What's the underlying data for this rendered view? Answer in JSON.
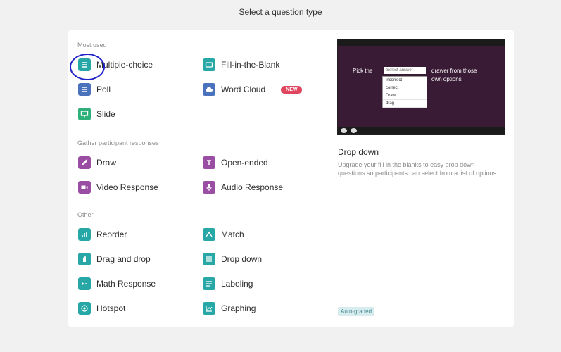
{
  "page": {
    "title": "Select a question type"
  },
  "sections": {
    "most_used": "Most used",
    "gather": "Gather participant responses",
    "other": "Other"
  },
  "items": {
    "multiple_choice": "Multiple-choice",
    "fill_blank": "Fill-in-the-Blank",
    "poll": "Poll",
    "word_cloud": "Word Cloud",
    "slide": "Slide",
    "draw": "Draw",
    "open_ended": "Open-ended",
    "video_response": "Video Response",
    "audio_response": "Audio Response",
    "reorder": "Reorder",
    "match": "Match",
    "drag_drop": "Drag and drop",
    "drop_down": "Drop down",
    "math_response": "Math Response",
    "labeling": "Labeling",
    "hotspot": "Hotspot",
    "graphing": "Graphing"
  },
  "badges": {
    "new": "NEW",
    "auto_graded": "Auto-graded"
  },
  "preview": {
    "text_left": "Pick the",
    "text_right": "drawer from those",
    "text_right2": "own options",
    "select_value": "Select answer",
    "options": [
      "incorrect",
      "correct",
      "Draw",
      "drag"
    ],
    "title": "Drop down",
    "description": "Upgrade your fill in the blanks to easy drop down questions so participants can select from a list of options."
  },
  "colors": {
    "teal": "#27a8a6",
    "blue": "#4a72bd",
    "green": "#2eb07b",
    "purple": "#9a4ea3",
    "badge_new": "#e0455e",
    "annotation_circle": "#1f22c8"
  }
}
